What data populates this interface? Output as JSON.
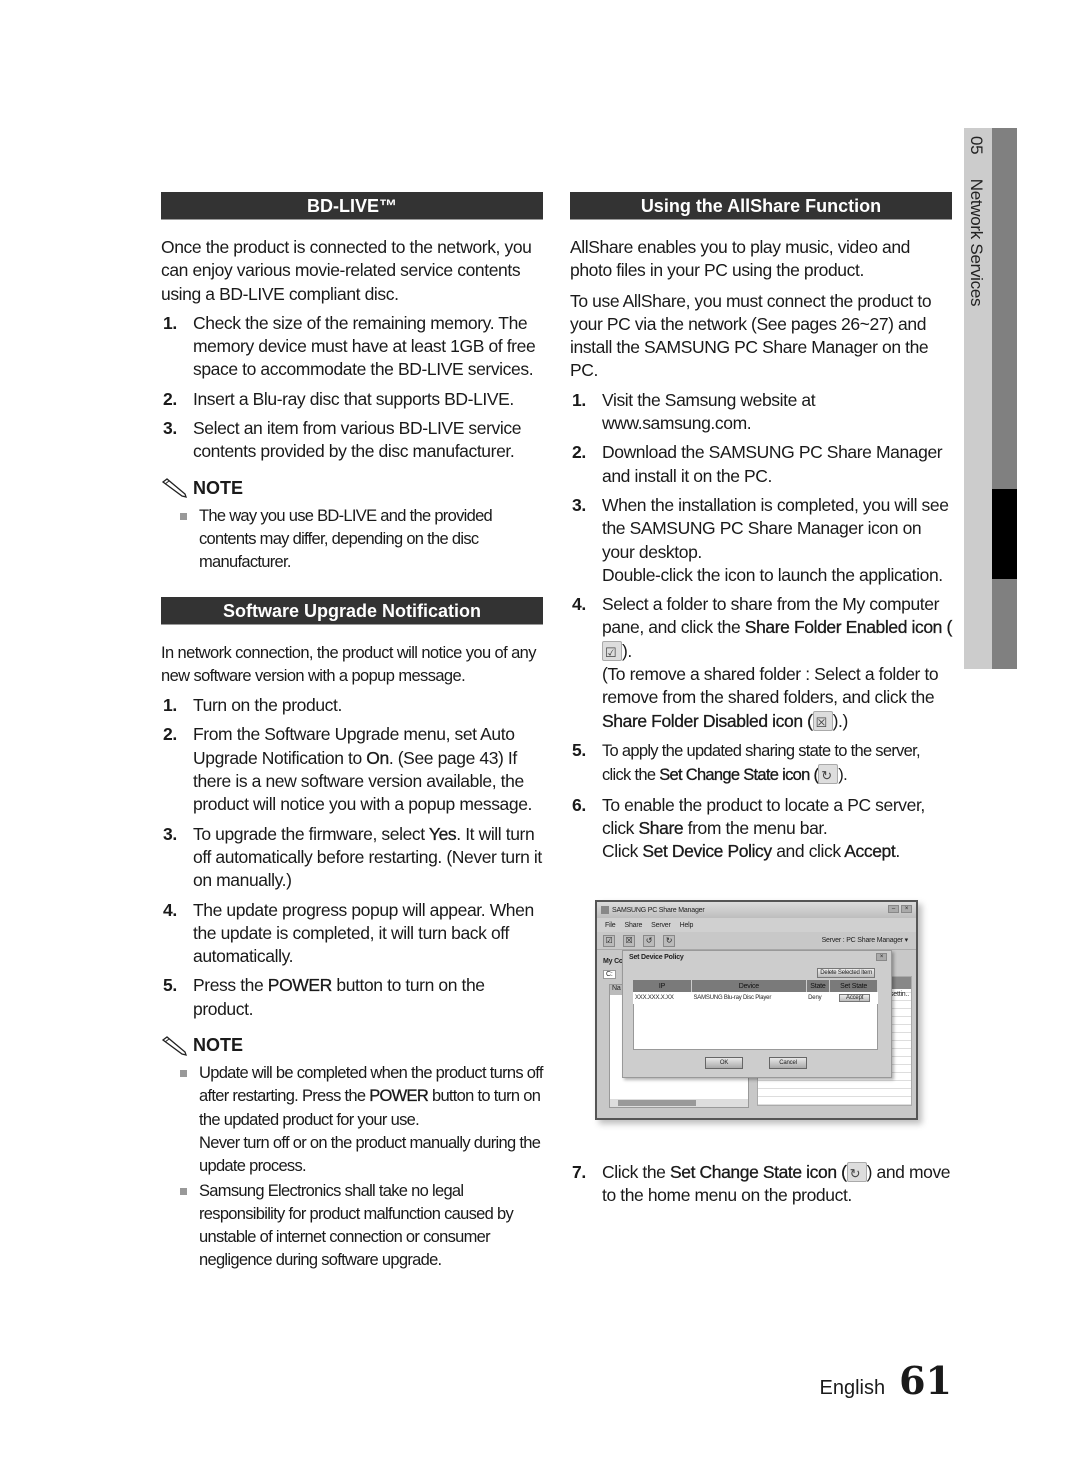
{
  "side_tab": {
    "chapter": "05",
    "title": "Network Services"
  },
  "left": {
    "bdlive": {
      "header": "BD-LIVE™",
      "intro": "Once the product is connected to the network, you can enjoy various movie-related service contents using a BD-LIVE compliant disc.",
      "steps": [
        {
          "num": "1.",
          "text": "Check the size of the remaining memory. The memory device must have at least 1GB of free space to accommodate the BD-LIVE services."
        },
        {
          "num": "2.",
          "text": "Insert a Blu-ray disc that supports BD-LIVE."
        },
        {
          "num": "3.",
          "text": "Select an item from various BD-LIVE service contents provided by the disc manufacturer."
        }
      ],
      "note_label": "NOTE",
      "notes": [
        "The way you use BD-LIVE and the provided contents may differ, depending on the disc manufacturer."
      ]
    },
    "upgrade": {
      "header": "Software Upgrade Notification",
      "intro": "In network connection, the product will notice you of any new software version with a popup message.",
      "steps": [
        {
          "num": "1.",
          "text": "Turn on the product."
        },
        {
          "num": "2.",
          "pre": "From the Software Upgrade menu, set Auto Upgrade Notification to ",
          "bold": "On",
          "post": ". (See page 43) If there is a new software version available, the product will notice you with a popup message."
        },
        {
          "num": "3.",
          "pre": "To upgrade the firmware, select ",
          "bold": "Yes",
          "post": ". It will turn off automatically before restarting. (Never turn it on manually.)"
        },
        {
          "num": "4.",
          "text": "The update progress popup will appear. When the update is completed, it will turn back off automatically."
        },
        {
          "num": "5.",
          "pre": "Press the ",
          "bold": "POWER",
          "post": " button to turn on the product."
        }
      ],
      "note_label": "NOTE",
      "notes": [
        {
          "pre": "Update will be completed when the product turns off after restarting. Press the ",
          "bold": "POWER",
          "post": " button to turn on the updated product for your use.",
          "extra": "Never turn off or on the product manually during the update process."
        },
        {
          "text": "Samsung Electronics shall take no legal responsibility for product malfunction caused by unstable of internet connection or consumer negligence during software upgrade."
        }
      ]
    }
  },
  "right": {
    "header": "Using the AllShare Function",
    "intro1": "AllShare enables you to play music, video and photo files in your PC using the product.",
    "intro2": "To use AllShare, you must connect the product to your PC via the network (See pages 26~27) and install the SAMSUNG PC Share Manager on the PC.",
    "steps": [
      {
        "num": "1.",
        "text": "Visit the Samsung website at www.samsung.com."
      },
      {
        "num": "2.",
        "text": "Download the SAMSUNG PC Share Manager and install it on the PC."
      },
      {
        "num": "3.",
        "text": "When the installation is completed, you will see the SAMSUNG PC Share Manager icon on your desktop.",
        "extra": "Double-click the icon to launch the application."
      },
      {
        "num": "4.",
        "pre": "Select a folder to share from the My computer pane, and click the ",
        "bold": "Share Folder Enabled icon (",
        "post": ").",
        "extra_pre": "(To remove a shared folder : Select a folder to remove from the shared folders, and click the ",
        "extra_bold": "Share Folder Disabled icon (",
        "extra_post": ").)"
      },
      {
        "num": "5.",
        "pre": "To apply the updated sharing state to the server, click the ",
        "bold": "Set Change State icon (",
        "post": ")."
      },
      {
        "num": "6.",
        "pre": "To enable the product to locate a PC server, click ",
        "bold": "Share",
        "post": " from the menu bar.",
        "extra_pre": "Click ",
        "extra_bold": "Set Device Policy",
        "extra_mid": " and click ",
        "extra_bold2": "Accept",
        "extra_post": "."
      },
      {
        "num": "7.",
        "pre": "Click the ",
        "bold": "Set Change State icon (",
        "post": ") and move to the home menu on the product."
      }
    ],
    "screenshot": {
      "title": "SAMSUNG PC Share Manager",
      "menu": [
        "File",
        "Share",
        "Server",
        "Help"
      ],
      "server_label": "Server : PC Share Manager",
      "my_computer": "My Co",
      "drive": "C:",
      "name_col": "Na",
      "setting_col": "settin..",
      "dialog": {
        "title": "Set Device Policy",
        "delete_button": "Delete Selected Item",
        "columns": [
          "IP",
          "Device",
          "State",
          "Set State"
        ],
        "rows": [
          {
            "ip": "XXX.XXX.X.XX",
            "device": "SAMSUNG Blu-ray Disc Player",
            "state": "Deny",
            "action": "Accept"
          }
        ],
        "ok": "OK",
        "cancel": "Cancel"
      }
    }
  },
  "footer": {
    "language": "English",
    "page": "61"
  }
}
